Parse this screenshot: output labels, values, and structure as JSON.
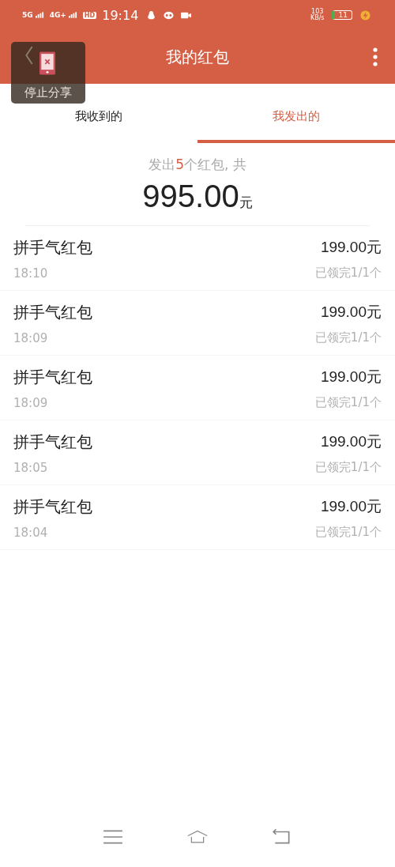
{
  "status_bar": {
    "network_1": "5G",
    "network_2": "4G+",
    "hd": "HD",
    "time": "19:14",
    "speed": "103",
    "speed_unit": "KB/s",
    "battery": "11"
  },
  "header": {
    "title": "我的红包"
  },
  "share_overlay": {
    "label": "停止分享"
  },
  "tabs": [
    {
      "label": "我收到的",
      "selected": false
    },
    {
      "label": "我发出的",
      "selected": true
    }
  ],
  "summary": {
    "prefix": "发出",
    "count": "5",
    "suffix": "个红包, 共",
    "amount": "995.00",
    "unit": "元"
  },
  "items": [
    {
      "name": "拼手气红包",
      "time": "18:10",
      "amount": "199.00元",
      "status": "已领完1/1个"
    },
    {
      "name": "拼手气红包",
      "time": "18:09",
      "amount": "199.00元",
      "status": "已领完1/1个"
    },
    {
      "name": "拼手气红包",
      "time": "18:09",
      "amount": "199.00元",
      "status": "已领完1/1个"
    },
    {
      "name": "拼手气红包",
      "time": "18:05",
      "amount": "199.00元",
      "status": "已领完1/1个"
    },
    {
      "name": "拼手气红包",
      "time": "18:04",
      "amount": "199.00元",
      "status": "已领完1/1个"
    }
  ]
}
